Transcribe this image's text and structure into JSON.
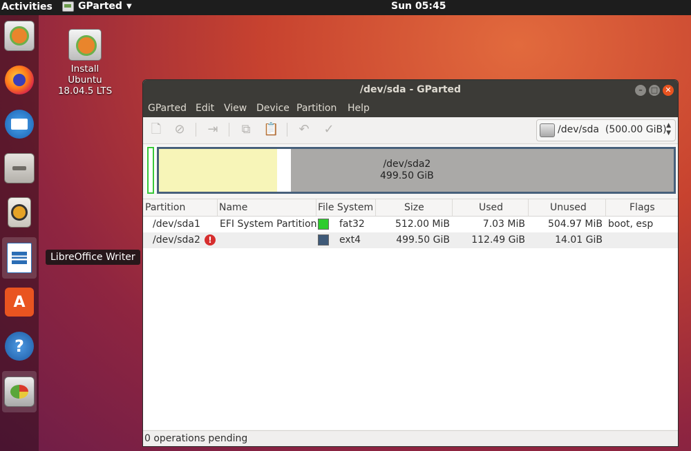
{
  "topbar": {
    "activities": "Activities",
    "app_name": "GParted",
    "clock": "Sun 05:45"
  },
  "desktop": {
    "install_icon_label_1": "Install",
    "install_icon_label_2": "Ubuntu",
    "install_icon_label_3": "18.04.5 LTS"
  },
  "dock": {
    "tooltip": "LibreOffice Writer",
    "items": [
      "installer-icon",
      "firefox-icon",
      "thunderbird-icon",
      "files-icon",
      "rhythmbox-icon",
      "libreoffice-writer-icon",
      "ubuntu-software-icon",
      "help-icon",
      "gparted-icon"
    ]
  },
  "window": {
    "title": "/dev/sda - GParted",
    "menu": [
      "GParted",
      "Edit",
      "View",
      "Device",
      "Partition",
      "Help"
    ],
    "device_selector": "/dev/sda  (500.00 GiB)",
    "map": {
      "partition": "/dev/sda2",
      "size": "499.50 GiB",
      "used_fraction": 0.23
    },
    "columns": [
      "Partition",
      "Name",
      "File System",
      "Size",
      "Used",
      "Unused",
      "Flags"
    ],
    "rows": [
      {
        "partition": "/dev/sda1",
        "name": "EFI System Partition",
        "fs_color": "#2ecc2e",
        "fs": "fat32",
        "size": "512.00 MiB",
        "used": "7.03 MiB",
        "unused": "504.97 MiB",
        "flags": "boot, esp"
      },
      {
        "partition": "/dev/sda2",
        "name": "",
        "fs_color": "#3f5a78",
        "fs": "ext4",
        "size": "499.50 GiB",
        "used": "112.49 GiB",
        "unused": "14.01 GiB",
        "flags": ""
      }
    ],
    "status": "0 operations pending"
  }
}
